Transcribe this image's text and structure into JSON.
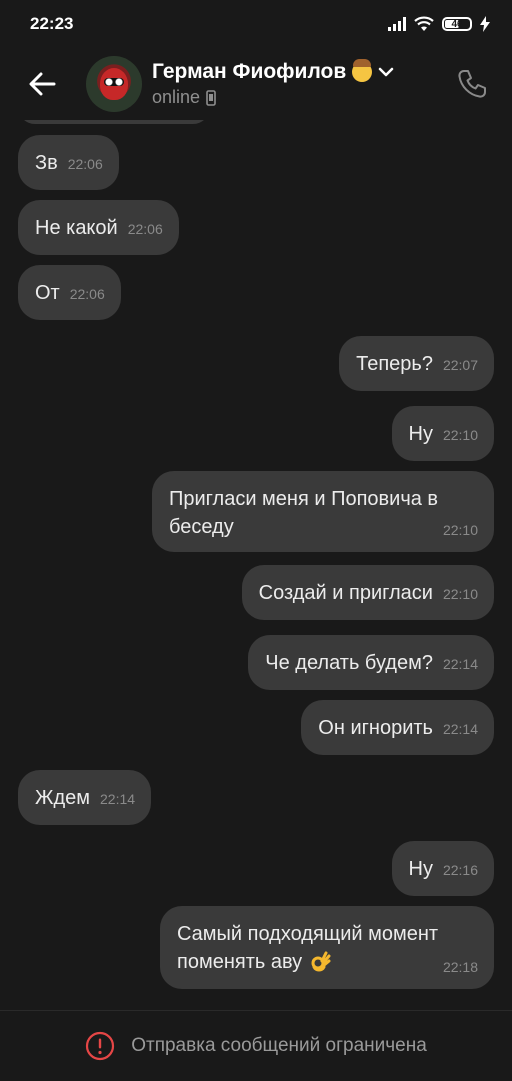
{
  "status_bar": {
    "time": "22:23",
    "battery": "46"
  },
  "header": {
    "name": "Герман Фиофилов",
    "status": "online"
  },
  "messages": [
    {
      "dir": "in",
      "text": "Зв",
      "time": "22:06"
    },
    {
      "dir": "in",
      "text": "Не какой",
      "time": "22:06"
    },
    {
      "dir": "in",
      "text": "От",
      "time": "22:06"
    },
    {
      "dir": "out",
      "text": "Теперь?",
      "time": "22:07"
    },
    {
      "dir": "out",
      "text": "Ну",
      "time": "22:10"
    },
    {
      "dir": "out",
      "text": "Пригласи меня и Поповича в беседу",
      "time": "22:10"
    },
    {
      "dir": "out",
      "text": "Создай и пригласи",
      "time": "22:10"
    },
    {
      "dir": "out",
      "text": "Че делать будем?",
      "time": "22:14"
    },
    {
      "dir": "out",
      "text": "Он игнорить",
      "time": "22:14"
    },
    {
      "dir": "in",
      "text": "Ждем",
      "time": "22:14"
    },
    {
      "dir": "out",
      "text": "Ну",
      "time": "22:16"
    },
    {
      "dir": "out",
      "text": "Самый подходящий момент поменять аву",
      "time": "22:18"
    }
  ],
  "footer": {
    "restriction_text": "Отправка сообщений ограничена"
  },
  "icons": {
    "back": "arrow-left-icon",
    "call": "phone-icon",
    "dropdown": "chevron-down-icon",
    "device": "mobile-icon",
    "warning": "exclamation-circle-icon",
    "emoji": "ok-hand-emoji"
  },
  "colors": {
    "background": "#191919",
    "bubble": "#3a3a3a",
    "warning": "#e64646"
  }
}
